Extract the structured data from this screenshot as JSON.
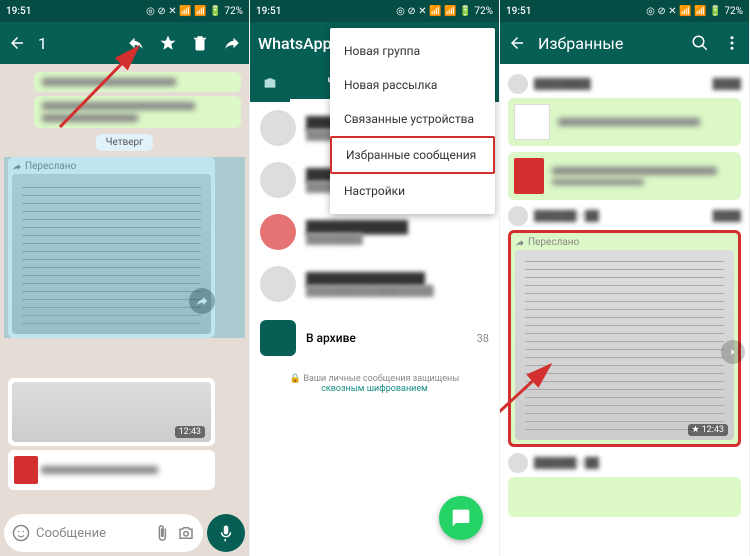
{
  "status": {
    "time": "19:51",
    "battery": "72%"
  },
  "s1": {
    "count": "1",
    "date": "Четверг",
    "forwarded": "Переслано",
    "time1": "12:43",
    "placeholder": "Сообщение"
  },
  "s2": {
    "title": "WhatsApp",
    "tab": "Чаты",
    "menu": [
      "Новая группа",
      "Новая рассылка",
      "Связанные устройства",
      "Избранные сообщения",
      "Настройки"
    ],
    "archive": "В архиве",
    "archive_count": "38",
    "encryption": "Ваши личные сообщения защищены ",
    "encryption_link": "сквозным шифрованием"
  },
  "s3": {
    "title": "Избранные",
    "forwarded": "Переслано",
    "time": "12:43"
  }
}
